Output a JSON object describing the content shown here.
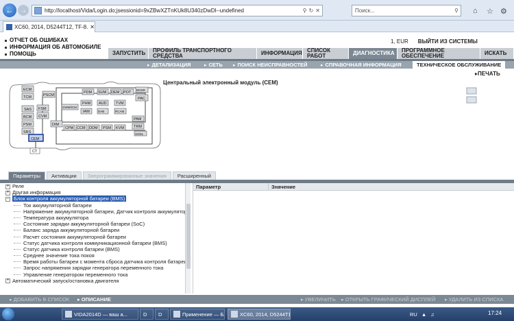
{
  "browser": {
    "url": "http://localhost/Vida/Login.do;jsessionid=9xZBwXZTnKUk8U340zDwDl--undefined",
    "search_placeholder": "Поиск...",
    "tab_title": "XC60, 2014, D5244T12, TF-8..."
  },
  "header": {
    "links": [
      "ОТЧЕТ ОБ ОШИБКАХ",
      "ИНФОРМАЦИЯ ОБ АВТОМОБИЛЕ",
      "ПОМОЩЬ"
    ],
    "locale": "1, EUR",
    "logout": "ВЫЙТИ ИЗ СИСТЕМЫ"
  },
  "main_nav": [
    {
      "label": "ЗАПУСТИТЬ",
      "active": false
    },
    {
      "label": "ПРОФИЛЬ ТРАНСПОРТНОГО СРЕДСТВА",
      "active": false
    },
    {
      "label": "ИНФОРМАЦИЯ",
      "active": false
    },
    {
      "label": "СПИСОК РАБОТ",
      "active": false
    },
    {
      "label": "ДИАГНОСТИКА",
      "active": true
    },
    {
      "label": "ПРОГРАММНОЕ ОБЕСПЕЧЕНИЕ",
      "active": false
    },
    {
      "label": "ИСКАТЬ",
      "active": false
    }
  ],
  "sub_nav": [
    "ДЕТАЛИЗАЦИЯ",
    "СЕТЬ",
    "ПОИСК НЕИСПРАВНОСТЕЙ",
    "СПРАВОЧНАЯ ИНФОРМАЦИЯ",
    "ТЕХНИЧЕСКОЕ ОБСЛУЖИВАНИЕ"
  ],
  "print_label": "ПЕЧАТЬ",
  "diagram": {
    "title": "Центральный электронный модуль (CEM)",
    "modules": [
      "ECM",
      "TCM",
      "PSCM",
      "SAS",
      "BCM",
      "PSM",
      "SRS",
      "FSM",
      "CVM",
      "DIM",
      "CEM",
      "CT",
      "PDM",
      "SUM",
      "DEM",
      "POT",
      "BOSR",
      "PAC",
      "PHM",
      "AUD",
      "TVM",
      "GWM/ICM",
      "IAM",
      "DAB",
      "RCAM",
      "CPM",
      "CCM",
      "DDM",
      "PSM",
      "KVM",
      "TRM",
      "PAM",
      "SODL"
    ],
    "selected": "CEM"
  },
  "lower_tabs": [
    {
      "label": "Параметры",
      "state": "active"
    },
    {
      "label": "Активации",
      "state": "normal"
    },
    {
      "label": "Запрограммированные значения",
      "state": "disabled"
    },
    {
      "label": "Расширенный",
      "state": "normal"
    }
  ],
  "tree": {
    "top": [
      {
        "label": "Реле",
        "expanded": false
      },
      {
        "label": "Другая информация",
        "expanded": false
      },
      {
        "label": "Блок контроля аккумуляторной батареи (BMS)",
        "expanded": true,
        "selected": true
      }
    ],
    "children": [
      "Ток аккумуляторной батареи",
      "Напряжение аккумуляторной батареи, Датчик контроля аккумулятора",
      "Температура аккумулятора",
      "Состояние зарядки аккумуляторной батареи (SoC)",
      "Баланс заряда аккумуляторной батареи",
      "Расчет состояния аккумуляторной батареи",
      "Статус датчика контроля коммуникационной батареи (BMS)",
      "Статус датчика контроля батареи (BMS)",
      "Среднее значение тока покоя",
      "Время работы батареи с момента сброса датчика контроля батареи",
      "Запрос напряжения зарядки генератора переменного тока",
      "Управление генератором переменного тока"
    ],
    "bottom": [
      {
        "label": "Автоматический запуск/остановка двигателя",
        "expanded": false
      }
    ]
  },
  "params_table": {
    "columns": [
      "Параметр",
      "Значение"
    ]
  },
  "actions": [
    {
      "label": "ДОБАВИТЬ В СПИСОК",
      "enabled": false
    },
    {
      "label": "ОПИСАНИЕ",
      "enabled": true
    },
    {
      "label": "УВЕЛИЧИТЬ",
      "enabled": false
    },
    {
      "label": "ОТКРЫТЬ ГРАФИЧЕСКИЙ ДИСПЛЕЙ",
      "enabled": false
    },
    {
      "label": "УДАЛИТЬ ИЗ СПИСКА",
      "enabled": false
    }
  ],
  "taskbar": {
    "items": [
      "VIDA2014D — ваш а...",
      "D",
      "D",
      "Применение — Бло...",
      "XC60, 2014, D5244T1..."
    ],
    "lang": "RU",
    "time": "17:24"
  },
  "colors": {
    "accent_nav": "#7c8893",
    "selection": "#2a5db0",
    "browser": "#dfe8f3"
  }
}
